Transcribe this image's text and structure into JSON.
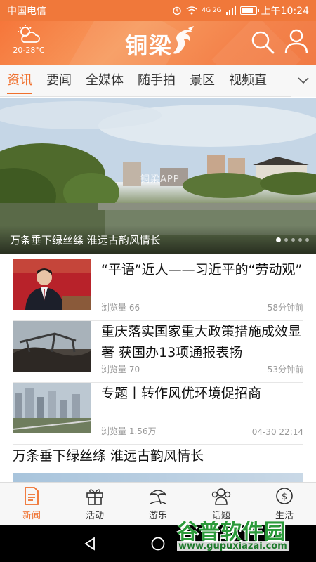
{
  "status_bar": {
    "carrier": "中国电信",
    "network_labels": "4G 2G",
    "time": "上午10:24",
    "battery_level": 0.85
  },
  "header": {
    "weather_temp": "20-28°C",
    "logo": "铜梁",
    "weather_icon": "cloud-sun-icon",
    "search_icon": "search-icon",
    "user_icon": "user-icon"
  },
  "tabs": [
    {
      "label": "资讯",
      "active": true
    },
    {
      "label": "要闻",
      "active": false
    },
    {
      "label": "全媒体",
      "active": false
    },
    {
      "label": "随手拍",
      "active": false
    },
    {
      "label": "景区",
      "active": false
    },
    {
      "label": "视频直",
      "active": false
    }
  ],
  "banner": {
    "caption": "万条垂下绿丝绦 淮远古韵风情长",
    "watermark": "铜梁APP",
    "slide_count": 5,
    "active_slide": 0
  },
  "news": [
    {
      "title": "“平语”近人——习近平的“劳动观”",
      "views_label": "浏览量",
      "views": "66",
      "time": "58分钟前"
    },
    {
      "title": "重庆落实国家重大政策措施成效显著 获国办13项通报表扬",
      "views_label": "浏览量",
      "views": "70",
      "time": "53分钟前"
    },
    {
      "title": "专题丨转作风优环境促招商",
      "views_label": "浏览量",
      "views": "1.56万",
      "time": "04-30 22:14"
    }
  ],
  "headline": "万条垂下绿丝绦 淮远古韵风情长",
  "bottom_nav": [
    {
      "label": "新闻",
      "icon": "news-icon",
      "active": true
    },
    {
      "label": "活动",
      "icon": "gift-icon",
      "active": false
    },
    {
      "label": "游乐",
      "icon": "umbrella-icon",
      "active": false
    },
    {
      "label": "话题",
      "icon": "people-icon",
      "active": false
    },
    {
      "label": "生活",
      "icon": "money-icon",
      "active": false
    }
  ],
  "site_watermark": {
    "title": "谷普软件园",
    "url": "www.gupuxiazai.com"
  },
  "colors": {
    "accent": "#f0702d",
    "header": "#f6763a"
  }
}
